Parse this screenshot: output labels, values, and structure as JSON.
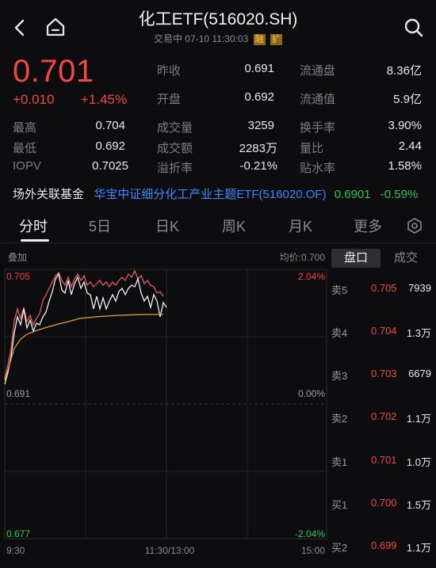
{
  "header": {
    "title": "化工ETF(516020.SH)",
    "status": "交易中",
    "datetime": "07-10 11:30:03",
    "badges": [
      "融",
      "扩"
    ]
  },
  "quote": {
    "price": "0.701",
    "change": "+0.010",
    "change_pct": "+1.45%"
  },
  "stats_mid": [
    {
      "label": "昨收",
      "value": "0.691"
    },
    {
      "label": "开盘",
      "value": "0.692"
    },
    {
      "label": "成交量",
      "value": "3259"
    },
    {
      "label": "成交额",
      "value": "2283万"
    },
    {
      "label": "溢折率",
      "value": "-0.21%"
    }
  ],
  "stats_right": [
    {
      "label": "流通盘",
      "value": "8.36亿"
    },
    {
      "label": "流通值",
      "value": "5.9亿"
    },
    {
      "label": "换手率",
      "value": "3.90%"
    },
    {
      "label": "量比",
      "value": "2.44"
    },
    {
      "label": "贴水率",
      "value": "1.58%"
    }
  ],
  "stats_left": [
    {
      "label": "最高",
      "value": "0.704"
    },
    {
      "label": "最低",
      "value": "0.692"
    },
    {
      "label": "IOPV",
      "value": "0.7025"
    }
  ],
  "fund": {
    "label": "场外关联基金",
    "name": "华宝中证细分化工产业主题ETF(516020.OF)",
    "price": "0.6901",
    "change": "-0.59%"
  },
  "tabs": [
    "分时",
    "5日",
    "日K",
    "周K",
    "月K",
    "更多"
  ],
  "chart": {
    "overlay_label": "叠加",
    "avg_label": "均价:0.700",
    "y_top_left": "0.705",
    "y_mid_left": "0.691",
    "y_bottom_left": "0.677",
    "y_top_right": "2.04%",
    "y_mid_right": "0.00%",
    "y_bottom_right": "-2.04%",
    "x_start": "9:30",
    "x_mid": "11:30/13:00",
    "x_end": "15:00"
  },
  "orderbook": {
    "tab_active": "盘口",
    "tab_other": "成交",
    "rows": [
      {
        "side": "卖5",
        "price": "0.705",
        "vol": "7939"
      },
      {
        "side": "卖4",
        "price": "0.704",
        "vol": "1.3万"
      },
      {
        "side": "卖3",
        "price": "0.703",
        "vol": "6679"
      },
      {
        "side": "卖2",
        "price": "0.702",
        "vol": "1.1万"
      },
      {
        "side": "卖1",
        "price": "0.701",
        "vol": "1.0万"
      },
      {
        "side": "买1",
        "price": "0.700",
        "vol": "1.5万"
      },
      {
        "side": "买2",
        "price": "0.699",
        "vol": "1.1万"
      }
    ]
  },
  "colors": {
    "up": "#f04848",
    "down": "#35c35a",
    "link": "#3d8bff",
    "avg_line": "#e6a23c",
    "price_line": "#f0f0f0"
  }
}
